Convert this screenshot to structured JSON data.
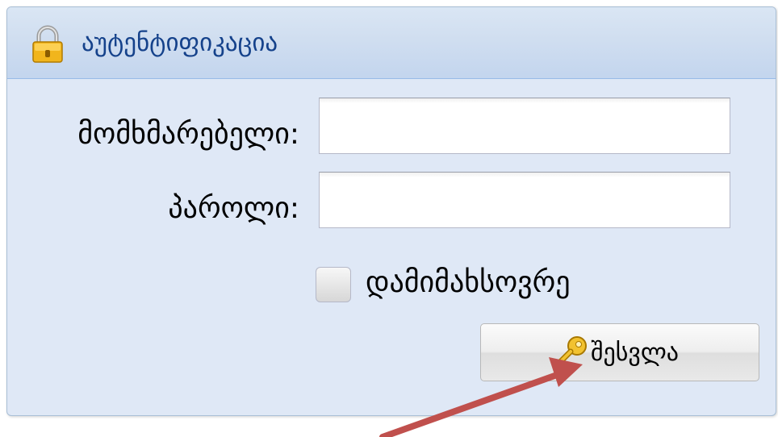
{
  "panel": {
    "title": "აუტენტიფიკაცია",
    "header_icon": "lock-icon"
  },
  "form": {
    "username_label": "მომხმარებელი:",
    "username_value": "",
    "password_label": "პაროლი:",
    "password_value": "",
    "remember_label": "დამიმახსოვრე",
    "remember_checked": false
  },
  "login_button": {
    "label": "შესვლა",
    "icon": "key-icon"
  },
  "annotation": {
    "icon": "red-arrow",
    "color": "#c0504d"
  },
  "colors": {
    "panel_bg": "#dfe8f6",
    "header_title": "#15428b",
    "panel_border": "#a9bfd6"
  }
}
